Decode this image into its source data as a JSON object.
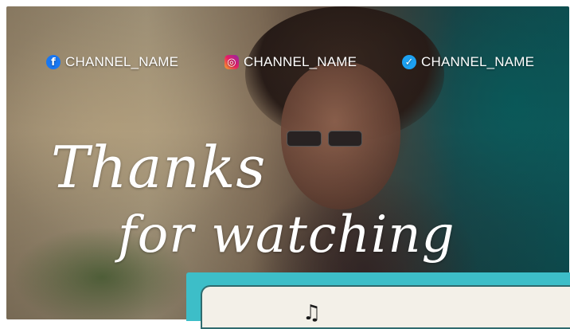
{
  "social": [
    {
      "icon": "facebook-icon",
      "glyph": "f",
      "label": "CHANNEL_NAME",
      "color": "#1877f2"
    },
    {
      "icon": "instagram-icon",
      "glyph": "◎",
      "label": "CHANNEL_NAME",
      "color": "#e91e63"
    },
    {
      "icon": "twitter-icon",
      "glyph": "✓",
      "label": "CHANNEL_NAME",
      "color": "#1da1f2"
    }
  ],
  "title": {
    "line1": "Thanks",
    "line2": "for watching"
  },
  "panel": {
    "icon": "music-note-icon",
    "glyph": "♫",
    "accent": "#3dbec8"
  }
}
